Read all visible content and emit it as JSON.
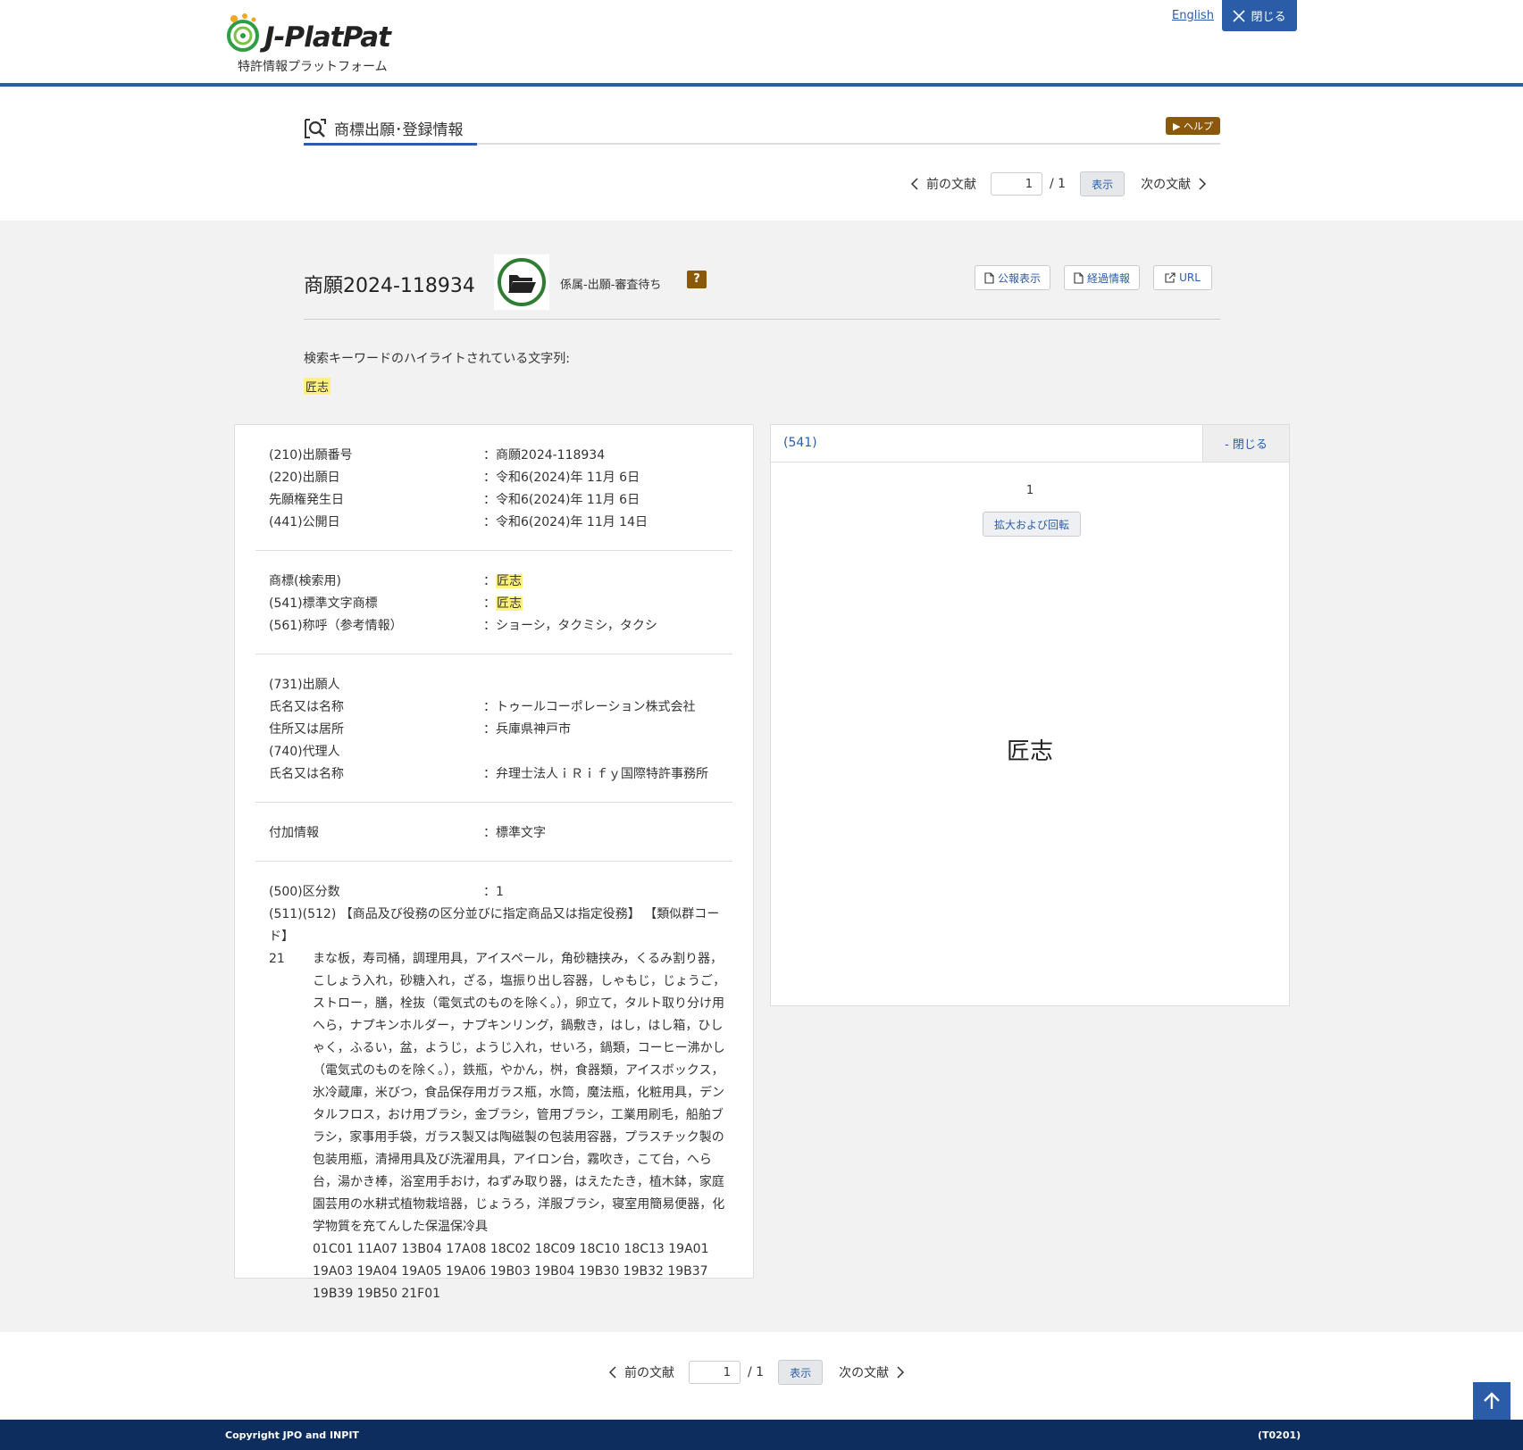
{
  "header": {
    "logo_text": "J-PlatPat",
    "logo_subtitle": "特許情報プラットフォーム",
    "lang_link": "English",
    "close_label": "閉じる"
  },
  "title": {
    "text": "商標出願･登録情報",
    "help_label": "ヘルプ"
  },
  "pager": {
    "prev_label": "前の文献",
    "page_value": "1",
    "of_label": "/ 1",
    "show_label": "表示",
    "next_label": "次の文献"
  },
  "record": {
    "doc_number": "商願2024-118934",
    "status_text": "係属-出願-審査待ち",
    "status_help": "?",
    "actions": {
      "gazette_label": "公報表示",
      "progress_label": "経過情報",
      "url_label": "URL"
    }
  },
  "keyword": {
    "label": "検索キーワードのハイライトされている文字列:",
    "value": "匠志"
  },
  "details": {
    "dates": [
      {
        "label": "(210)出願番号",
        "value": "：商願2024-118934"
      },
      {
        "label": "(220)出願日",
        "value": "：令和6(2024)年 11月 6日"
      },
      {
        "label": "先願権発生日",
        "value": "：令和6(2024)年 11月 6日"
      },
      {
        "label": "(441)公開日",
        "value": "：令和6(2024)年 11月 14日"
      }
    ],
    "mark": {
      "search_label": "商標(検索用)",
      "search_value": "匠志",
      "standard_label": "(541)標準文字商標",
      "standard_value": "匠志",
      "reading_label": "(561)称呼（参考情報）",
      "reading_value": "：ショーシ，タクミシ，タクシ"
    },
    "parties": [
      {
        "label": "(731)出願人",
        "value": ""
      },
      {
        "label": "氏名又は名称",
        "value": "：トゥールコーポレーション株式会社"
      },
      {
        "label": "住所又は居所",
        "value": "：兵庫県神戸市"
      },
      {
        "label": "(740)代理人",
        "value": ""
      },
      {
        "label": "氏名又は名称",
        "value": "：弁理士法人ｉＲｉｆｙ国際特許事務所"
      }
    ],
    "extra": {
      "label": "付加情報",
      "value": "：標準文字"
    },
    "goods": {
      "count_label": "(500)区分数",
      "count_value": "：1",
      "heading": "(511)(512) 【商品及び役務の区分並びに指定商品又は指定役務】 【類似群コード】",
      "class_no": "21",
      "text": "まな板，寿司桶，調理用具，アイスペール，角砂糖挟み，くるみ割り器，こしょう入れ，砂糖入れ，ざる，塩振り出し容器，しゃもじ，じょうご，ストロー，膳，栓抜（電気式のものを除く。），卵立て，タルト取り分け用へら，ナプキンホルダー，ナプキンリング，鍋敷き，はし，はし箱，ひしゃく，ふるい，盆，ようじ，ようじ入れ，せいろ，鍋類，コーヒー沸かし（電気式のものを除く。），鉄瓶，やかん，桝，食器類，アイスボックス，氷冷蔵庫，米びつ，食品保存用ガラス瓶，水筒，魔法瓶，化粧用具，デンタルフロス，おけ用ブラシ，金ブラシ，管用ブラシ，工業用刷毛，船舶ブラシ，家事用手袋，ガラス製又は陶磁製の包装用容器，プラスチック製の包装用瓶，清掃用具及び洗濯用具，アイロン台，霧吹き，こて台，へら台，湯かき棒，浴室用手おけ，ねずみ取り器，はえたたき，植木鉢，家庭園芸用の水耕式植物栽培器，じょうろ，洋服ブラシ，寝室用簡易便器，化学物質を充てんした保温保冷具",
      "codes": "01C01 11A07 13B04 17A08 18C02 18C09 18C10 18C13 19A01 19A03 19A04 19A05 19A06 19B03 19B04 19B30 19B32 19B37 19B39 19B50 21F01"
    }
  },
  "image_panel": {
    "title": "(541)",
    "close_label": "- 閉じる",
    "page_number": "1",
    "zoom_label": "拡大および回転",
    "mark_text": "匠志"
  },
  "footer": {
    "copyright": "Copyright JPO and INPIT",
    "code": "(T0201)"
  },
  "colors": {
    "accent": "#2a5ca8",
    "badge": "#8a5a0a",
    "highlight": "#fff27a",
    "footer_bg": "#0d2d5e",
    "status_ring": "#2e7d32"
  }
}
